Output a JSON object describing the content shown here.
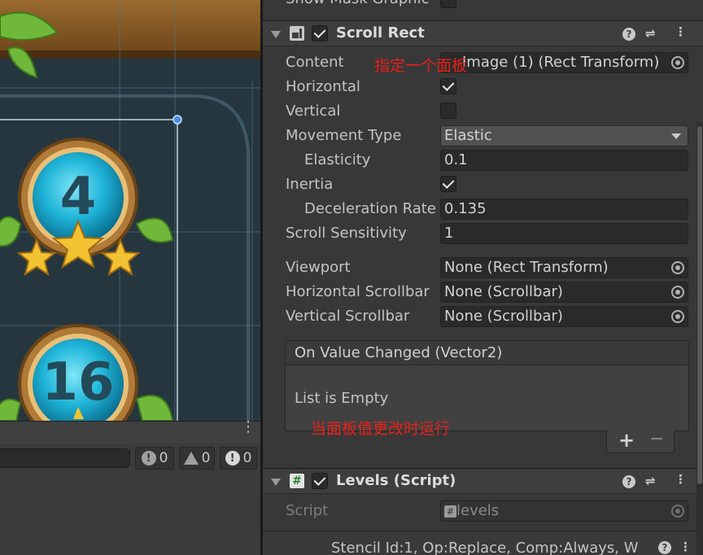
{
  "scene": {
    "level_top": "4",
    "level_bottom": "16"
  },
  "console": {
    "info_count": "0",
    "warn_count": "0",
    "error_count": "0"
  },
  "inspector": {
    "prev_row_label": "Show Mask Graphic",
    "scroll_rect": {
      "title": "Scroll Rect",
      "content_label": "Content",
      "content_value": "Image (1) (Rect Transform)",
      "horizontal_label": "Horizontal",
      "vertical_label": "Vertical",
      "movement_type_label": "Movement Type",
      "movement_type_value": "Elastic",
      "elasticity_label": "Elasticity",
      "elasticity_value": "0.1",
      "inertia_label": "Inertia",
      "deceleration_label": "Deceleration Rate",
      "deceleration_value": "0.135",
      "sensitivity_label": "Scroll Sensitivity",
      "sensitivity_value": "1",
      "viewport_label": "Viewport",
      "viewport_value": "None (Rect Transform)",
      "hscroll_label": "Horizontal Scrollbar",
      "hscroll_value": "None (Scrollbar)",
      "vscroll_label": "Vertical Scrollbar",
      "vscroll_value": "None (Scrollbar)",
      "event_title": "On Value Changed (Vector2)",
      "event_empty": "List is Empty",
      "add_label": "+",
      "remove_label": "−"
    },
    "annotation_content": "指定一个面板",
    "annotation_event": "当面板值更改时运行",
    "levels": {
      "title": "Levels (Script)",
      "script_label": "Script",
      "script_value": "levels"
    },
    "footer_text": "Stencil Id:1, Op:Replace, Comp:Always, W"
  },
  "colors": {
    "annotation": "#e8201a",
    "inspector_bg": "#383838",
    "orb": "#1fb4d8"
  }
}
